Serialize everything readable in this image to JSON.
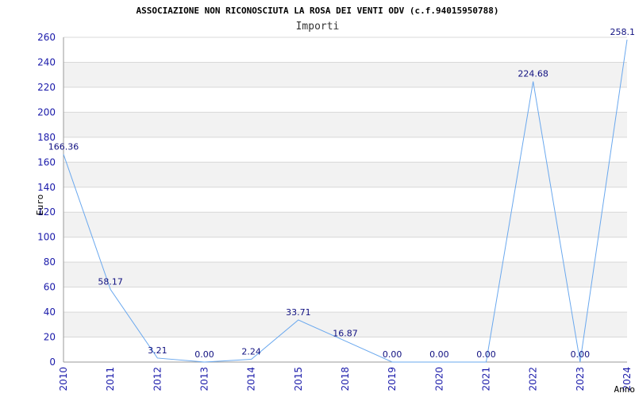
{
  "chart_data": {
    "type": "line",
    "title": "ASSOCIAZIONE NON RICONOSCIUTA LA ROSA DEI VENTI ODV (c.f.94015950788)",
    "subtitle": "Importi",
    "xlabel": "Anno",
    "ylabel": "Euro",
    "categories": [
      "2010",
      "2011",
      "2012",
      "2013",
      "2014",
      "2015",
      "2018",
      "2019",
      "2020",
      "2021",
      "2022",
      "2023",
      "2024"
    ],
    "series": [
      {
        "values": [
          166.36,
          58.17,
          3.21,
          0.0,
          2.24,
          33.71,
          16.87,
          0.0,
          0.0,
          0.0,
          224.68,
          0.0,
          258.1
        ]
      }
    ],
    "value_labels": [
      "166.36",
      "58.17",
      "3.21",
      "0.00",
      "2.24",
      "33.71",
      "16.87",
      "0.00",
      "0.00",
      "0.00",
      "224.68",
      "0.00",
      "258.1"
    ],
    "yticks": [
      0,
      20,
      40,
      60,
      80,
      100,
      120,
      140,
      160,
      180,
      200,
      220,
      240,
      260
    ],
    "ylim": [
      0,
      260
    ],
    "grid": true,
    "line_color": "#6aa8ee",
    "band_color": "#f2f2f2",
    "grid_color": "#d8d8d8"
  }
}
